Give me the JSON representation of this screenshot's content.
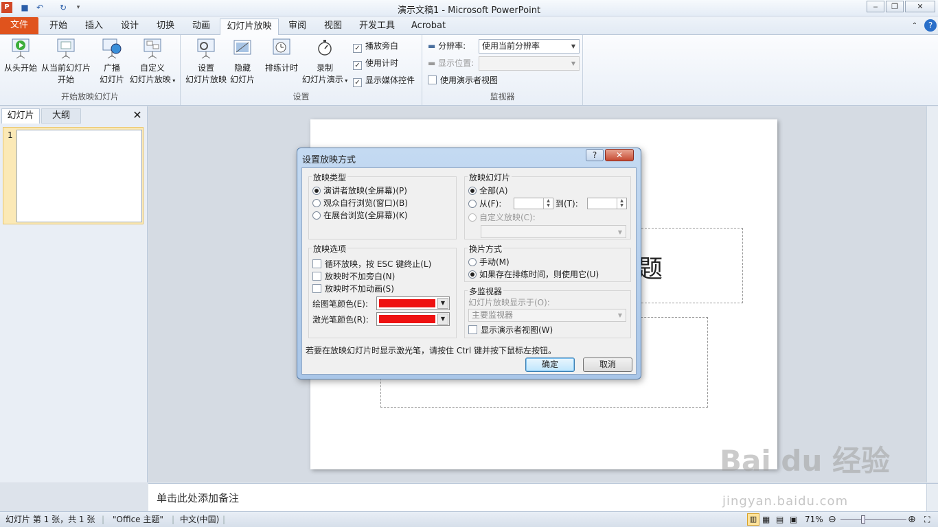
{
  "window": {
    "title": "演示文稿1 - Microsoft PowerPoint"
  },
  "tabs": [
    "文件",
    "开始",
    "插入",
    "设计",
    "切换",
    "动画",
    "幻灯片放映",
    "审阅",
    "视图",
    "开发工具",
    "Acrobat"
  ],
  "ribbon": {
    "group_start": {
      "label": "开始放映幻灯片",
      "from_start": "从头开始",
      "from_current_1": "从当前幻灯片",
      "from_current_2": "开始",
      "broadcast_1": "广播",
      "broadcast_2": "幻灯片",
      "custom_1": "自定义",
      "custom_2": "幻灯片放映"
    },
    "group_setup": {
      "label": "设置",
      "setup_1": "设置",
      "setup_2": "幻灯片放映",
      "hide_1": "隐藏",
      "hide_2": "幻灯片",
      "rehearse": "排练计时",
      "record_1": "录制",
      "record_2": "幻灯片演示",
      "play_narrations": "播放旁白",
      "use_timings": "使用计时",
      "show_media": "显示媒体控件"
    },
    "group_monitor": {
      "label": "监视器",
      "resolution_label": "分辨率:",
      "resolution_value": "使用当前分辨率",
      "show_on_label": "显示位置:",
      "presenter_view": "使用演示者视图"
    }
  },
  "leftpane": {
    "tab_slides": "幻灯片",
    "tab_outline": "大纲",
    "slide_number": "1"
  },
  "slide": {
    "title_fragment": "题"
  },
  "notes": {
    "placeholder": "单击此处添加备注"
  },
  "status": {
    "slide_info": "幻灯片 第 1 张，共 1 张",
    "theme": "\"Office 主题\"",
    "language": "中文(中国)",
    "zoom": "71%"
  },
  "dialog": {
    "title": "设置放映方式",
    "show_type": {
      "label": "放映类型",
      "options": [
        "演讲者放映(全屏幕)(P)",
        "观众自行浏览(窗口)(B)",
        "在展台浏览(全屏幕)(K)"
      ],
      "selected": 0
    },
    "show_options": {
      "label": "放映选项",
      "loop": "循环放映，按 ESC 键终止(L)",
      "no_narration": "放映时不加旁白(N)",
      "no_animation": "放映时不加动画(S)",
      "pen_color": "绘图笔颜色(E):",
      "laser_color": "激光笔颜色(R):",
      "pen_hex": "#ee1111"
    },
    "show_slides": {
      "label": "放映幻灯片",
      "all": "全部(A)",
      "from": "从(F):",
      "to": "到(T):",
      "custom": "自定义放映(C):"
    },
    "advance": {
      "label": "换片方式",
      "manual": "手动(M)",
      "timings": "如果存在排练时间，则使用它(U)"
    },
    "multi_monitor": {
      "label": "多监视器",
      "display_on": "幻灯片放映显示于(O):",
      "monitor_value": "主要监视器",
      "presenter_view": "显示演示者视图(W)"
    },
    "hint": "若要在放映幻灯片时显示激光笔，请按住 Ctrl 键并按下鼠标左按钮。",
    "ok": "确定",
    "cancel": "取消"
  },
  "watermark": {
    "brand": "Bai du 经验",
    "url": "jingyan.baidu.com"
  }
}
